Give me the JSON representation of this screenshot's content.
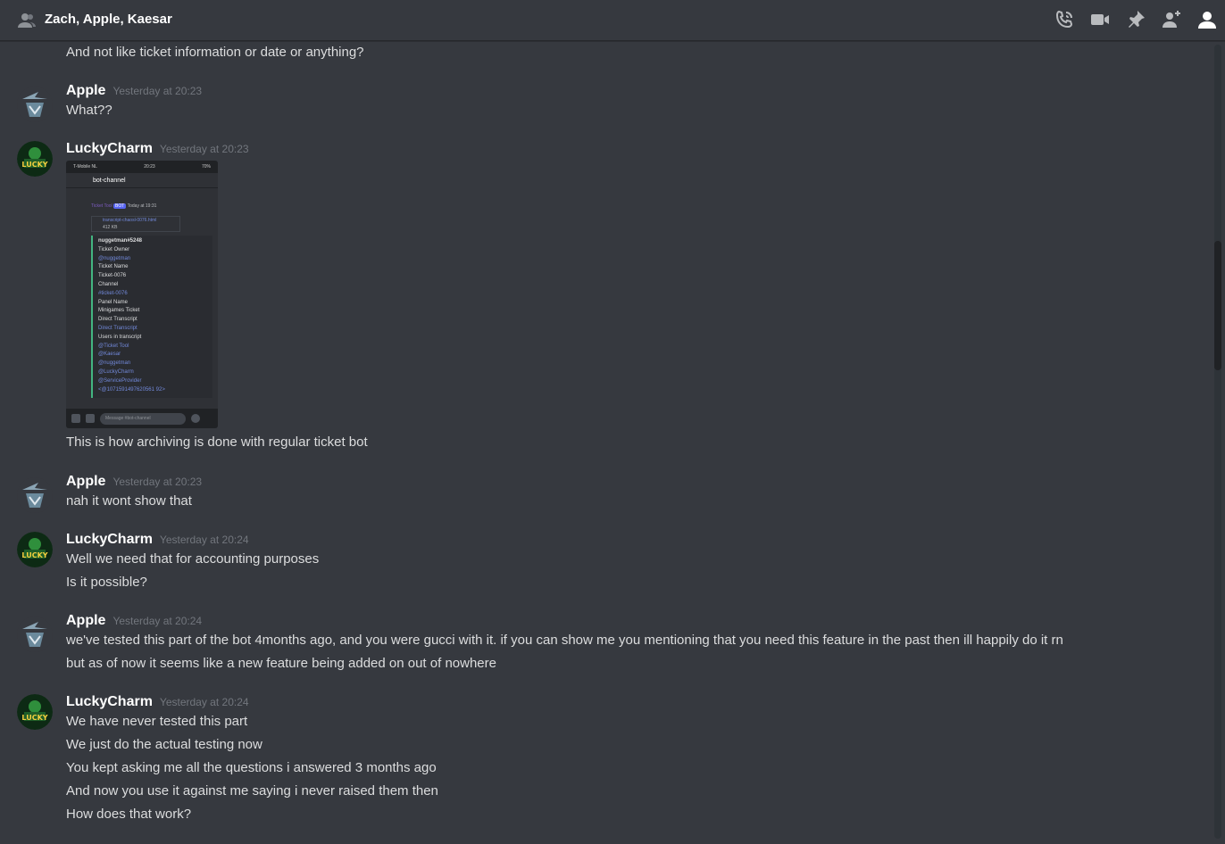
{
  "header": {
    "title": "Zach, Apple, Kaesar",
    "icons": [
      "people-icon",
      "call-icon",
      "video-icon",
      "pin-icon",
      "add-member-icon",
      "members-icon"
    ]
  },
  "colors": {
    "background": "#36393f",
    "author": "#ffffff",
    "text": "#dcddde",
    "timestamp": "#72767d",
    "embed_border": "#43b581"
  },
  "messages": [
    {
      "author": "",
      "timestamp": "",
      "lines": [
        "And not like ticket information or date or anything?"
      ]
    },
    {
      "author": "Apple",
      "timestamp": "Yesterday at 20:23",
      "lines": [
        "What??"
      ]
    },
    {
      "author": "LuckyCharm",
      "timestamp": "Yesterday at 20:23",
      "attachment": {
        "status_left": "T-Mobile NL",
        "status_time": "20:23",
        "status_right": "70%",
        "channel": "bot-channel",
        "bot_name": "Ticket Tool",
        "bot_badge": "BOT",
        "bot_time": "Today at 19:31",
        "file": "transcript-chaosl-0076.html",
        "file_size": "412 KB",
        "embed_lines": [
          "nuggetman#5248",
          "Ticket Owner",
          "@nuggetman",
          "Ticket Name",
          "Ticket-0076",
          "Channel",
          "#ticket-0076",
          "Panel Name",
          "Minigames Ticket",
          "Direct Transcript",
          "Direct Transcript",
          "Users in transcript",
          "@Ticket Tool",
          "@Kaesar",
          "@nuggetman",
          "@LuckyCharm",
          "@ServiceProvider",
          "<@1071591497620561 92>"
        ],
        "message_placeholder": "Message #bot-channel"
      },
      "lines": [
        "This is how archiving is done with regular ticket bot"
      ]
    },
    {
      "author": "Apple",
      "timestamp": "Yesterday at 20:23",
      "lines": [
        "nah it wont show that"
      ]
    },
    {
      "author": "LuckyCharm",
      "timestamp": "Yesterday at 20:24",
      "lines": [
        "Well we need that for accounting purposes",
        "Is it possible?"
      ]
    },
    {
      "author": "Apple",
      "timestamp": "Yesterday at 20:24",
      "lines": [
        "we've tested this part of the bot 4months ago, and you were gucci with it. if you can show me you mentioning that you need this feature in the past then ill happily do it rn",
        "but as of now it seems like a new feature being added on out of nowhere"
      ]
    },
    {
      "author": "LuckyCharm",
      "timestamp": "Yesterday at 20:24",
      "lines": [
        "We have never tested this part",
        "We just do the actual testing now",
        "You kept asking me all the questions i answered 3 months ago",
        "And now you use it against me saying i never raised them then",
        "How does that work?"
      ]
    }
  ]
}
